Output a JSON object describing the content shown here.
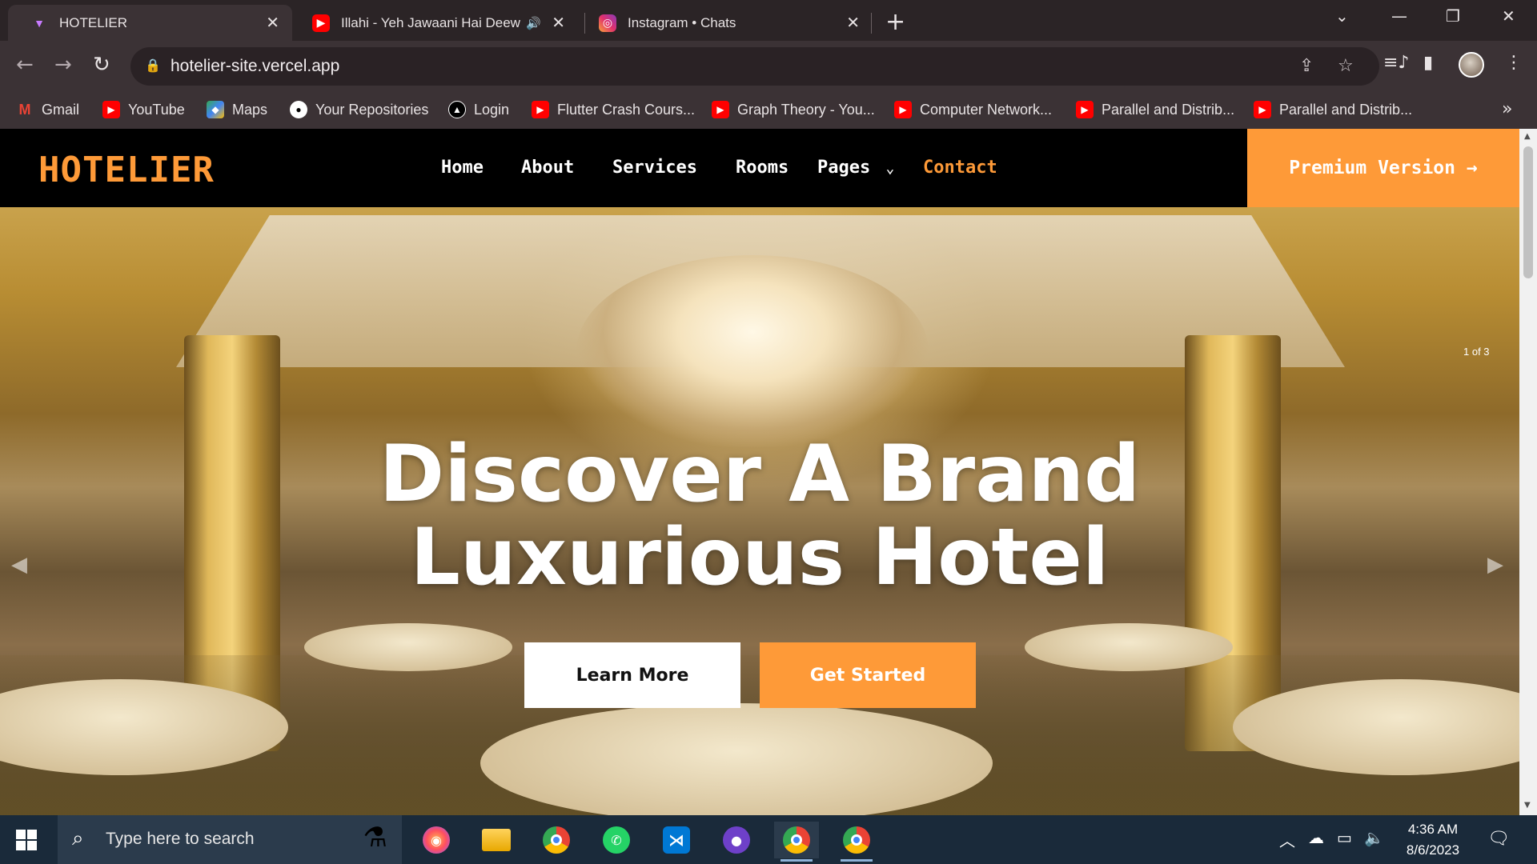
{
  "browser": {
    "tabs": [
      {
        "title": "HOTELIER",
        "active": true
      },
      {
        "title": "Illahi - Yeh Jawaani Hai Deew",
        "active": false,
        "audio": true
      },
      {
        "title": "Instagram • Chats",
        "active": false
      }
    ],
    "url": "hotelier-site.vercel.app",
    "bookmarks": [
      {
        "label": "Gmail",
        "icon": "gmail-icon"
      },
      {
        "label": "YouTube",
        "icon": "youtube-icon"
      },
      {
        "label": "Maps",
        "icon": "maps-icon"
      },
      {
        "label": "Your Repositories",
        "icon": "github-icon"
      },
      {
        "label": "Login",
        "icon": "login-icon"
      },
      {
        "label": "Flutter Crash Cours...",
        "icon": "youtube-icon"
      },
      {
        "label": "Graph Theory - You...",
        "icon": "youtube-icon"
      },
      {
        "label": "Computer Network...",
        "icon": "youtube-icon"
      },
      {
        "label": "Parallel and Distrib...",
        "icon": "youtube-icon"
      },
      {
        "label": "Parallel and Distrib...",
        "icon": "youtube-icon"
      }
    ],
    "bookmarks_more": "»"
  },
  "site": {
    "brand": "HOTELIER",
    "nav": [
      {
        "label": "Home",
        "active": false
      },
      {
        "label": "About",
        "active": false
      },
      {
        "label": "Services",
        "active": false
      },
      {
        "label": "Rooms",
        "active": false
      },
      {
        "label": "Pages",
        "active": false,
        "dropdown": true
      },
      {
        "label": "Contact",
        "active": true
      }
    ],
    "premium_label": "Premium Version →",
    "hero": {
      "title_line1": "Discover A Brand",
      "title_line2": "Luxurious Hotel",
      "learn_more": "Learn More",
      "get_started": "Get Started",
      "slide_counter": "1 of 3"
    },
    "accent": "#fe9a38"
  },
  "taskbar": {
    "search_placeholder": "Type here to search",
    "time": "4:36 AM",
    "date": "8/6/2023"
  }
}
